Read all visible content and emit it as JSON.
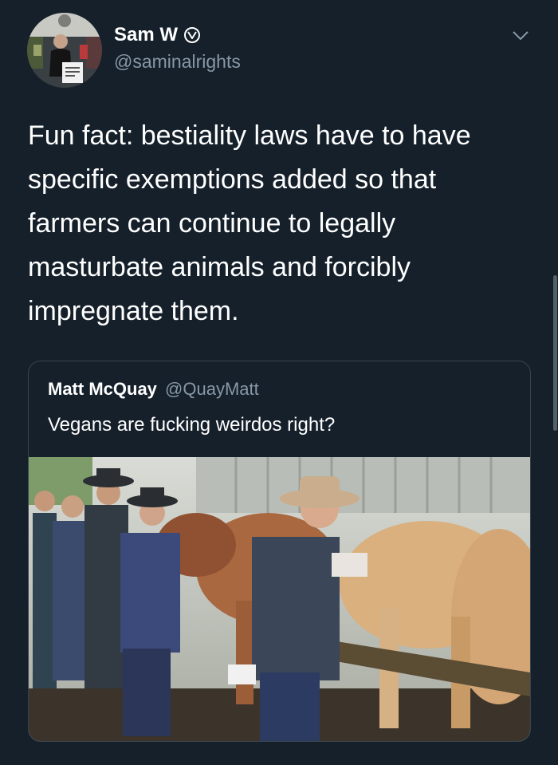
{
  "author": {
    "display_name": "Sam W",
    "handle": "@saminalrights",
    "verified_icon": "vegan-v-badge-icon"
  },
  "tweet": {
    "text": "Fun fact: bestiality laws have to have specific exemptions added so that farmers can continue to legally masturbate animals and forcibly impregnate them."
  },
  "quoted_tweet": {
    "display_name": "Matt McQuay",
    "handle": "@QuayMatt",
    "text": "Vegans are fucking weirdos right?",
    "photo_subject": "people in cowboy hats and plaid shirts standing beside cows in a barn"
  },
  "colors": {
    "background": "#15202b",
    "secondary_text": "#8899a6",
    "border": "#38444d"
  }
}
